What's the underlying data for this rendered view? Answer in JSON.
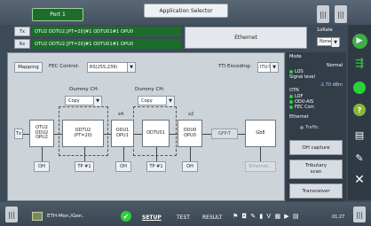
{
  "header": {
    "port_tab": "Port 1",
    "app_title": "Application Selector",
    "window_button": "|||",
    "close_button": "|||"
  },
  "signal_path": {
    "tx_label": "Tx",
    "rx_label": "Rx",
    "tx_strip": "OTU2  ODTU2.[PT=20]#1  ODTU01#1  OPU0",
    "rx_strip": "OTU2  ODTU2.[PT=20]#1  ODTU01#1  OPU0",
    "ethernet": "Ethernet",
    "rate_label": "1oRate",
    "rate_value": "None"
  },
  "config": {
    "mapping_button": "Mapping",
    "fec_label": "FEC Control:",
    "fec_value": "RS(255,239)",
    "tti_label": "TTI Encoding:",
    "tti_value": "ITU-T"
  },
  "diagram": {
    "dummy1_label": "Dummy CH:",
    "dummy1_value": "Copy",
    "dummy2_label": "Dummy CH:",
    "dummy2_value": "Copy",
    "mult_x4": "x4",
    "mult_x2": "x2",
    "tx": "Tx",
    "otu_line1": "OTU2",
    "otu_line2": "ODU2",
    "otu_line3": "OPU2",
    "otu2e_line1": "ODTU2",
    "otu2e_line2": "(PT=20)",
    "odu1_line1": "ODU1",
    "odu1_line2": "OPU1",
    "odtu": "ODTU01",
    "odu0_line1": "ODU0",
    "odu0_line2": "OPU0",
    "gfp": "GFP-T",
    "gbe": "GbE",
    "oh1": "OH",
    "tp1": "TP #1",
    "oh2": "OH",
    "tp2": "TP #1",
    "oh3": "OH",
    "gbe_disabled": "Ethernet..."
  },
  "status": {
    "mode": "Mode",
    "norm": "Normal",
    "los": "LOS",
    "signal_level": "Signal level",
    "dbm": "-2.70 dBm",
    "otn": "OTN",
    "lof": "LOF",
    "odu_ais": "ODU-AIS",
    "fec_corr": "FEC Corr.",
    "ethernet": "Ethernet",
    "traffic": "Traffic",
    "oh_capture": "OH capture",
    "tributary_scan_1": "Tributary",
    "tributary_scan_2": "scan",
    "rx_save": "Transceiver"
  },
  "footer": {
    "left_button": "|||",
    "right_button": "|||",
    "module_name": "ETH-Mon./Gen.",
    "tab_setup": "SETUP",
    "tab_test": "TEST",
    "tab_result": "RESULT",
    "status_icons": "⚑ ◘ ✎ ▮ V ▦ ▶ ▤",
    "clock": "01:27"
  },
  "icons": {
    "play": "play-icon",
    "run": "run-icon",
    "led": "led-icon",
    "help": "help-icon",
    "report": "report-icon",
    "edit": "edit-icon",
    "close": "close-icon"
  },
  "colors": {
    "path_green": "#1b6e2a",
    "led_green": "#2bd13c",
    "panel_bg": "#323d48"
  }
}
